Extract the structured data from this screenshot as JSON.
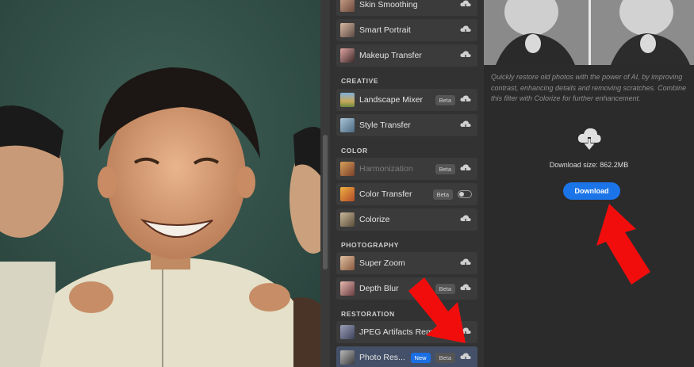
{
  "filters": {
    "top_items": [
      {
        "label": "Skin Smoothing",
        "icon": "skin-smoothing-thumb"
      },
      {
        "label": "Smart Portrait",
        "icon": "smart-portrait-thumb"
      },
      {
        "label": "Makeup Transfer",
        "icon": "makeup-transfer-thumb"
      }
    ],
    "sections": [
      {
        "title": "CREATIVE",
        "items": [
          {
            "label": "Landscape Mixer",
            "badge": "Beta"
          },
          {
            "label": "Style Transfer"
          }
        ]
      },
      {
        "title": "COLOR",
        "items": [
          {
            "label": "Harmonization",
            "badge": "Beta",
            "disabled": true
          },
          {
            "label": "Color Transfer",
            "badge": "Beta",
            "toggle": true
          },
          {
            "label": "Colorize"
          }
        ]
      },
      {
        "title": "PHOTOGRAPHY",
        "items": [
          {
            "label": "Super Zoom"
          },
          {
            "label": "Depth Blur",
            "badge": "Beta"
          }
        ]
      },
      {
        "title": "RESTORATION",
        "items": [
          {
            "label": "JPEG Artifacts Remo"
          },
          {
            "label": "Photo Res...",
            "badge_new": "New",
            "badge": "Beta",
            "selected": true
          }
        ]
      }
    ]
  },
  "detail": {
    "description": "Quickly restore old photos with the power of AI, by improving contrast, enhancing details and removing scratches. Combine this filter with Colorize for further enhancement.",
    "download_size": "Download size: 862.2MB",
    "download_label": "Download"
  },
  "colors": {
    "accent": "#1b74e8",
    "annotation_arrow": "#f20d0d",
    "panel_bg": "#323232",
    "item_bg": "#3b3b3b"
  }
}
